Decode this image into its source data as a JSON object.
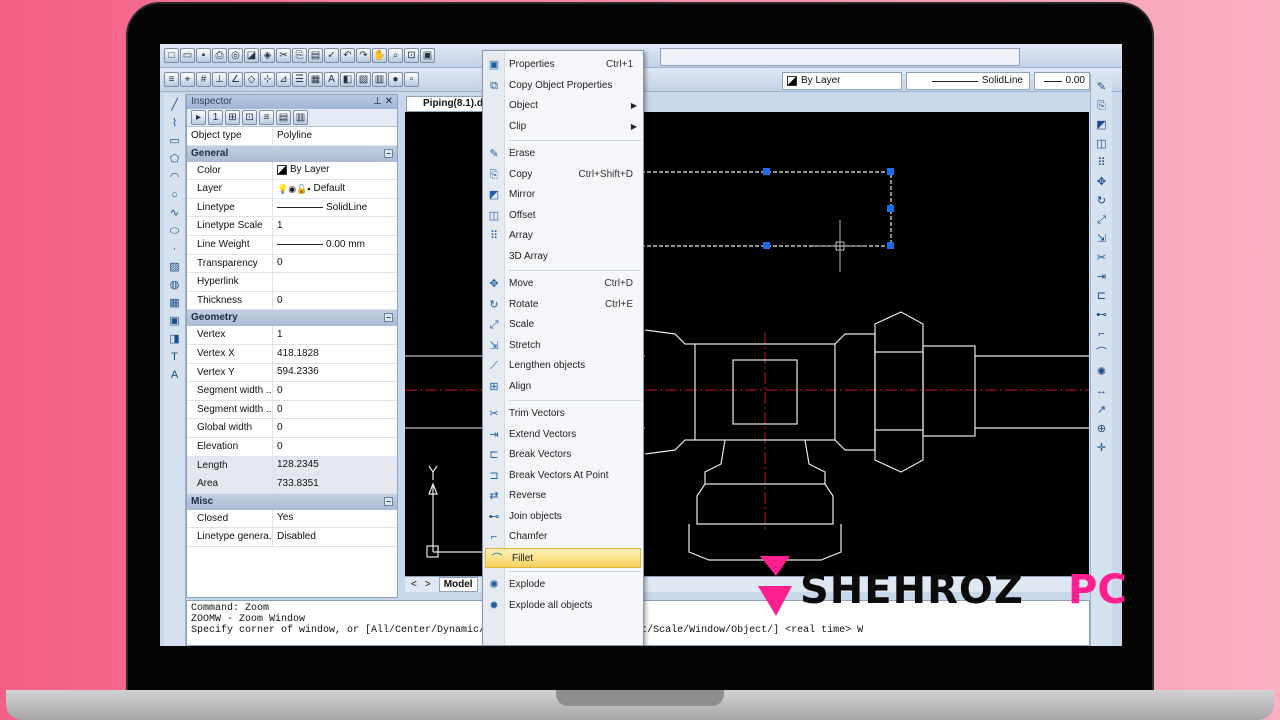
{
  "toolbar": {
    "layer_value": "By Layer",
    "linetype_value": "SolidLine",
    "lineweight_value": "0.00"
  },
  "inspector": {
    "title": "Inspector",
    "top_rows": [
      {
        "k": "Object type",
        "v": "Polyline"
      }
    ],
    "groups": [
      {
        "name": "General",
        "rows": [
          {
            "k": "Color",
            "v": "By Layer",
            "icon": "swatch"
          },
          {
            "k": "Layer",
            "v": "Default",
            "icon": "layer"
          },
          {
            "k": "Linetype",
            "v": "SolidLine",
            "icon": "line"
          },
          {
            "k": "Linetype Scale",
            "v": "1"
          },
          {
            "k": "Line Weight",
            "v": "0.00 mm",
            "icon": "line"
          },
          {
            "k": "Transparency",
            "v": "0"
          },
          {
            "k": "Hyperlink",
            "v": ""
          },
          {
            "k": "Thickness",
            "v": "0"
          }
        ]
      },
      {
        "name": "Geometry",
        "rows": [
          {
            "k": "Vertex",
            "v": "1"
          },
          {
            "k": "Vertex X",
            "v": "418.1828"
          },
          {
            "k": "Vertex Y",
            "v": "594.2336"
          },
          {
            "k": "Segment width ...",
            "v": "0"
          },
          {
            "k": "Segment width ...",
            "v": "0"
          },
          {
            "k": "Global width",
            "v": "0"
          },
          {
            "k": "Elevation",
            "v": "0"
          },
          {
            "k": "Length",
            "v": "128.2345",
            "shade": true
          },
          {
            "k": "Area",
            "v": "733.8351",
            "shade": true
          }
        ]
      },
      {
        "name": "Misc",
        "rows": [
          {
            "k": "Closed",
            "v": "Yes"
          },
          {
            "k": "Linetype genera...",
            "v": "Disabled"
          }
        ]
      }
    ]
  },
  "document": {
    "tab": "Piping(8.1).dv",
    "model_tab": "Model"
  },
  "command": {
    "lines": [
      "Command: Zoom",
      "ZOOMW - Zoom Window",
      "Specify corner of window, or [All/Center/Dynamic/Extents/Left/Previous/Right/Scale/Window/Object/] <real time> W"
    ]
  },
  "context_menu": {
    "items": [
      {
        "label": "Properties",
        "shortcut": "Ctrl+1",
        "icon": "properties-icon",
        "glyph": "▣"
      },
      {
        "label": "Copy Object Properties",
        "shortcut": "",
        "icon": "copy-properties-icon",
        "glyph": "⧉"
      },
      {
        "label": "Object",
        "shortcut": "",
        "submenu": true
      },
      {
        "label": "Clip",
        "shortcut": "",
        "submenu": true
      },
      {
        "sep": true
      },
      {
        "label": "Erase",
        "shortcut": "",
        "icon": "erase-icon",
        "glyph": "✎"
      },
      {
        "label": "Copy",
        "shortcut": "Ctrl+Shift+D",
        "icon": "copy-icon",
        "glyph": "⎘"
      },
      {
        "label": "Mirror",
        "shortcut": "",
        "icon": "mirror-icon",
        "glyph": "◩"
      },
      {
        "label": "Offset",
        "shortcut": "",
        "icon": "offset-icon",
        "glyph": "◫"
      },
      {
        "label": "Array",
        "shortcut": "",
        "icon": "array-icon",
        "glyph": "⠿"
      },
      {
        "label": "3D Array",
        "shortcut": ""
      },
      {
        "sep": true
      },
      {
        "label": "Move",
        "shortcut": "Ctrl+D",
        "icon": "move-icon",
        "glyph": "✥"
      },
      {
        "label": "Rotate",
        "shortcut": "Ctrl+E",
        "icon": "rotate-icon",
        "glyph": "↻"
      },
      {
        "label": "Scale",
        "shortcut": "",
        "icon": "scale-icon",
        "glyph": "⤢"
      },
      {
        "label": "Stretch",
        "shortcut": "",
        "icon": "stretch-icon",
        "glyph": "⇲"
      },
      {
        "label": "Lengthen objects",
        "shortcut": "",
        "icon": "lengthen-icon",
        "glyph": "⟋"
      },
      {
        "label": "Align",
        "shortcut": "",
        "icon": "align-icon",
        "glyph": "⊞"
      },
      {
        "sep": true
      },
      {
        "label": "Trim Vectors",
        "shortcut": "",
        "icon": "trim-icon",
        "glyph": "✂"
      },
      {
        "label": "Extend Vectors",
        "shortcut": "",
        "icon": "extend-icon",
        "glyph": "⇥"
      },
      {
        "label": "Break Vectors",
        "shortcut": "",
        "icon": "break-icon",
        "glyph": "⊏"
      },
      {
        "label": "Break Vectors At Point",
        "shortcut": "",
        "icon": "break-point-icon",
        "glyph": "⊐"
      },
      {
        "label": "Reverse",
        "shortcut": "",
        "icon": "reverse-icon",
        "glyph": "⇄"
      },
      {
        "label": "Join objects",
        "shortcut": "",
        "icon": "join-icon",
        "glyph": "⊷"
      },
      {
        "label": "Chamfer",
        "shortcut": "",
        "icon": "chamfer-icon",
        "glyph": "⌐"
      },
      {
        "label": "Fillet",
        "shortcut": "",
        "icon": "fillet-icon",
        "glyph": "⌒",
        "highlight": true
      },
      {
        "sep": true
      },
      {
        "label": "Explode",
        "shortcut": "",
        "icon": "explode-icon",
        "glyph": "✺"
      },
      {
        "label": "Explode all objects",
        "shortcut": "",
        "icon": "explode-all-icon",
        "glyph": "✹"
      }
    ]
  },
  "watermark": {
    "part1": "SHEHROZ",
    "part2": "PC"
  },
  "colors": {
    "accent": "#ff1f8e",
    "canvas": "#000000",
    "menu_highlight": "#f6d25f",
    "background": "#f45f84"
  }
}
